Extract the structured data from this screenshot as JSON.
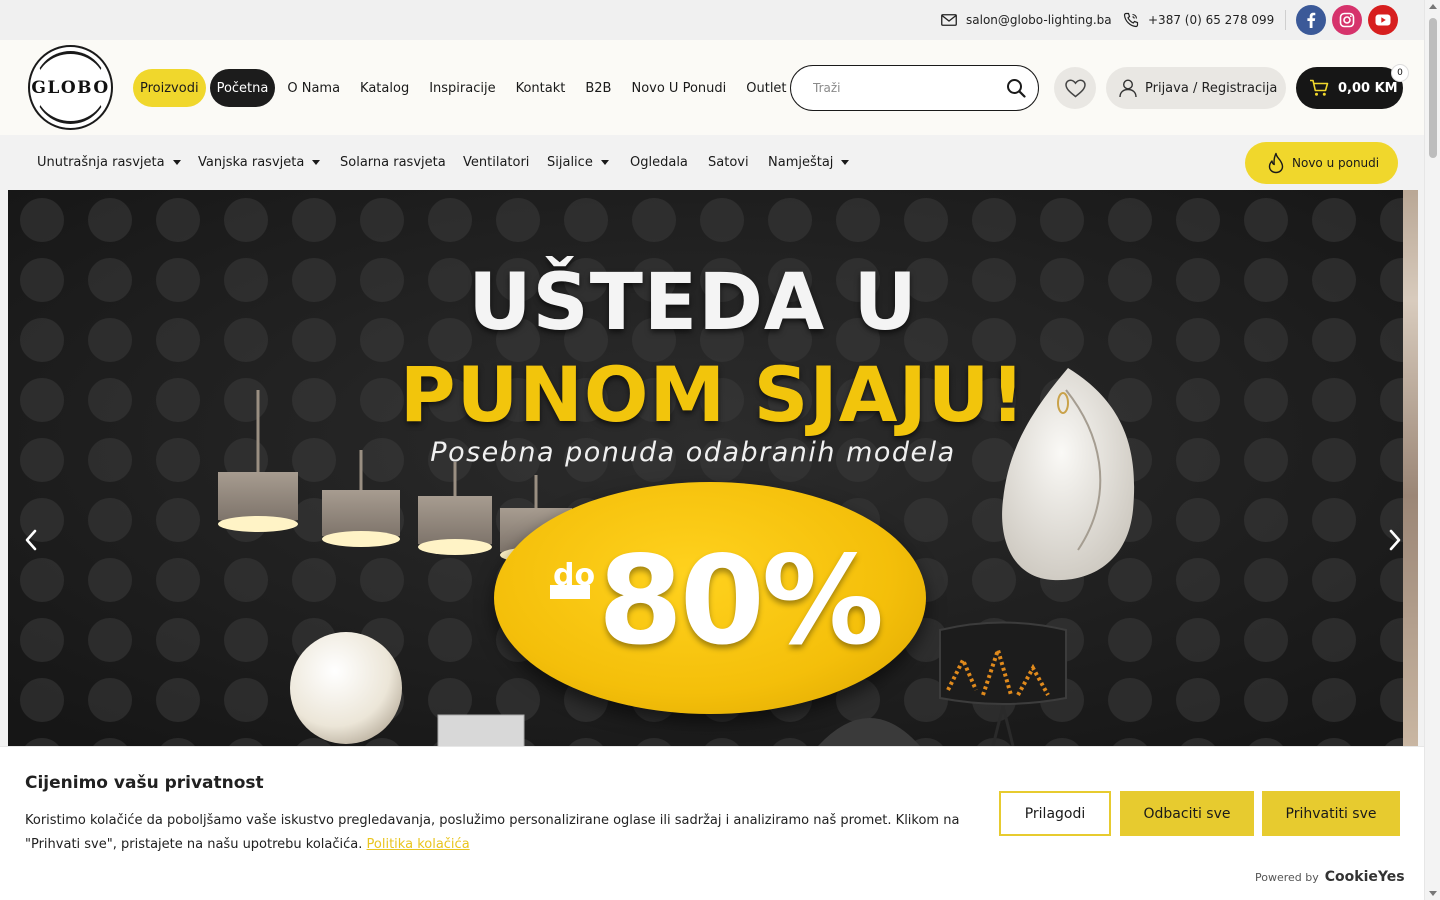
{
  "topbar": {
    "email": "salon@globo-lighting.ba",
    "phone": "+387 (0) 65 278 099",
    "social": [
      {
        "name": "facebook-icon",
        "color": "#3b5998"
      },
      {
        "name": "instagram-icon",
        "color": "#d6336c"
      },
      {
        "name": "youtube-icon",
        "color": "#d71e1e"
      }
    ]
  },
  "header": {
    "logo_text": "GLOBO",
    "nav": [
      {
        "label": "Proizvodi",
        "style": "yellow"
      },
      {
        "label": "Početna",
        "style": "dark"
      },
      {
        "label": "O Nama"
      },
      {
        "label": "Katalog"
      },
      {
        "label": "Inspiracije"
      },
      {
        "label": "Kontakt"
      },
      {
        "label": "B2B"
      },
      {
        "label": "Novo U Ponudi"
      },
      {
        "label": "Outlet"
      }
    ],
    "search_placeholder": "Traži",
    "login_label": "Prijava / Registracija",
    "cart_total": "0,00 KM",
    "cart_count": "0"
  },
  "categories": {
    "items": [
      {
        "label": "Unutrašnja rasvjeta",
        "dropdown": true
      },
      {
        "label": "Vanjska rasvjeta",
        "dropdown": true
      },
      {
        "label": "Solarna rasvjeta",
        "dropdown": false
      },
      {
        "label": "Ventilatori",
        "dropdown": false
      },
      {
        "label": "Sijalice",
        "dropdown": true
      },
      {
        "label": "Ogledala",
        "dropdown": false
      },
      {
        "label": "Satovi",
        "dropdown": false
      },
      {
        "label": "Namještaj",
        "dropdown": true
      }
    ],
    "new_button": "Novo u ponudi"
  },
  "hero": {
    "line1": "UŠTEDA U",
    "line2": "PUNOM SJAJU!",
    "subtitle": "Posebna ponuda odabranih modela",
    "discount_prefix": "do",
    "discount_value": "80%",
    "accent_color": "#f2c50c"
  },
  "cookie": {
    "title": "Cijenimo vašu privatnost",
    "text": "Koristimo kolačiće da poboljšamo vaše iskustvo pregledavanja, poslužimo personalizirane oglase ili sadržaj i analiziramo naš promet. Klikom na \"Prihvati sve\", pristajete na našu upotrebu kolačića.",
    "link": "Politika kolačića",
    "customize": "Prilagodi",
    "reject": "Odbaciti sve",
    "accept": "Prihvatiti sve",
    "powered_by": "Powered by",
    "brand": "CookieYes",
    "accent_color": "#e7cb2f"
  }
}
